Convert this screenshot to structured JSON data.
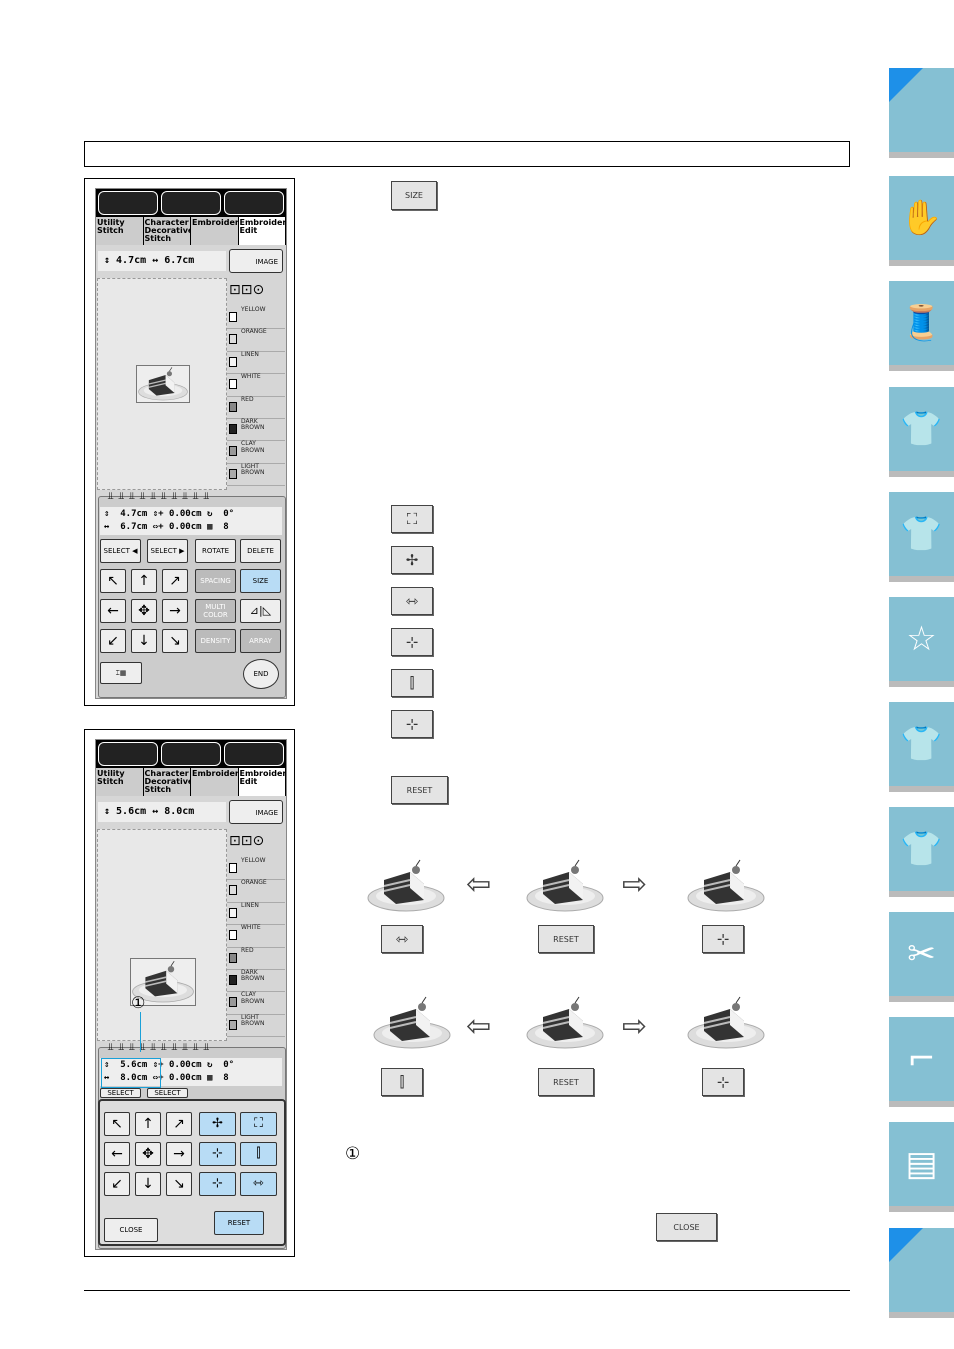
{
  "screen": {
    "categories": [
      "Utility\nStitch",
      "Character\nDecorative\nStitch",
      "Embroidery",
      "Embroidery\nEdit"
    ],
    "image_label": "IMAGE",
    "colors": [
      {
        "name": "YELLOW",
        "hex": "#ffffff"
      },
      {
        "name": "ORANGE",
        "hex": "#dddddd"
      },
      {
        "name": "LINEN",
        "hex": "#f4f4f4"
      },
      {
        "name": "WHITE",
        "hex": "#ffffff"
      },
      {
        "name": "RED",
        "hex": "#888888"
      },
      {
        "name": "DARK\nBROWN",
        "hex": "#222222"
      },
      {
        "name": "CLAY\nBROWN",
        "hex": "#999999"
      },
      {
        "name": "LIGHT\nBROWN",
        "hex": "#aaaaaa"
      }
    ]
  },
  "panel1": {
    "dim": "↕ 4.7cm ↔ 6.7cm",
    "info": "⇕  4.7cm ⇕+ 0.00cm ↻  0°\n↔  6.7cm ⇔+ 0.00cm ▦  8",
    "buttons": {
      "select_left": "SELECT ◀",
      "select_right": "SELECT ▶",
      "rotate": "ROTATE",
      "delete": "DELETE",
      "spacing": "SPACING",
      "size": "SIZE",
      "multi_color": "MULTI COLOR",
      "mirror": "⊿|◺",
      "density": "DENSITY",
      "array": "ARRAY",
      "end": "END"
    }
  },
  "panel2": {
    "dim": "↕ 5.6cm ↔ 8.0cm",
    "info": "⇕  5.6cm ⇕+ 0.00cm ↻  0°\n↔  8.0cm ⇔+ 0.00cm ▦  8",
    "select_left": "SELECT",
    "select_right": "SELECT",
    "close": "CLOSE",
    "reset": "RESET"
  },
  "callout": "①",
  "right": {
    "size_button": "SIZE",
    "size_icons": [
      "enlarge-proportional-icon",
      "reduce-proportional-icon",
      "stretch-horizontal-icon",
      "compress-horizontal-icon",
      "stretch-vertical-icon",
      "compress-vertical-icon"
    ],
    "reset_button": "RESET",
    "row1": {
      "left_button": "stretch-horizontal-icon",
      "middle_button": "RESET",
      "right_button": "compress-horizontal-icon"
    },
    "row2": {
      "left_button": "stretch-vertical-icon",
      "middle_button": "RESET",
      "right_button": "compress-vertical-icon"
    },
    "callout": "①",
    "close_button": "CLOSE"
  },
  "side_tabs": [
    "",
    "sewing-machine-hand-icon",
    "thread-spools-icon",
    "tshirt-icon",
    "tshirt-abc-icon",
    "embroidery-frame-star-icon",
    "tshirt-embroidery-icon",
    "tshirt-edit-icon",
    "sewing-machine-maintenance-icon",
    "sewing-machine-icon",
    "pages-icon",
    ""
  ],
  "colors": {
    "tab": "#85c0d3",
    "tab_corner": "#1e90e8",
    "active_button": "#b8dcf5",
    "callout_line": "#1aa0d8"
  }
}
